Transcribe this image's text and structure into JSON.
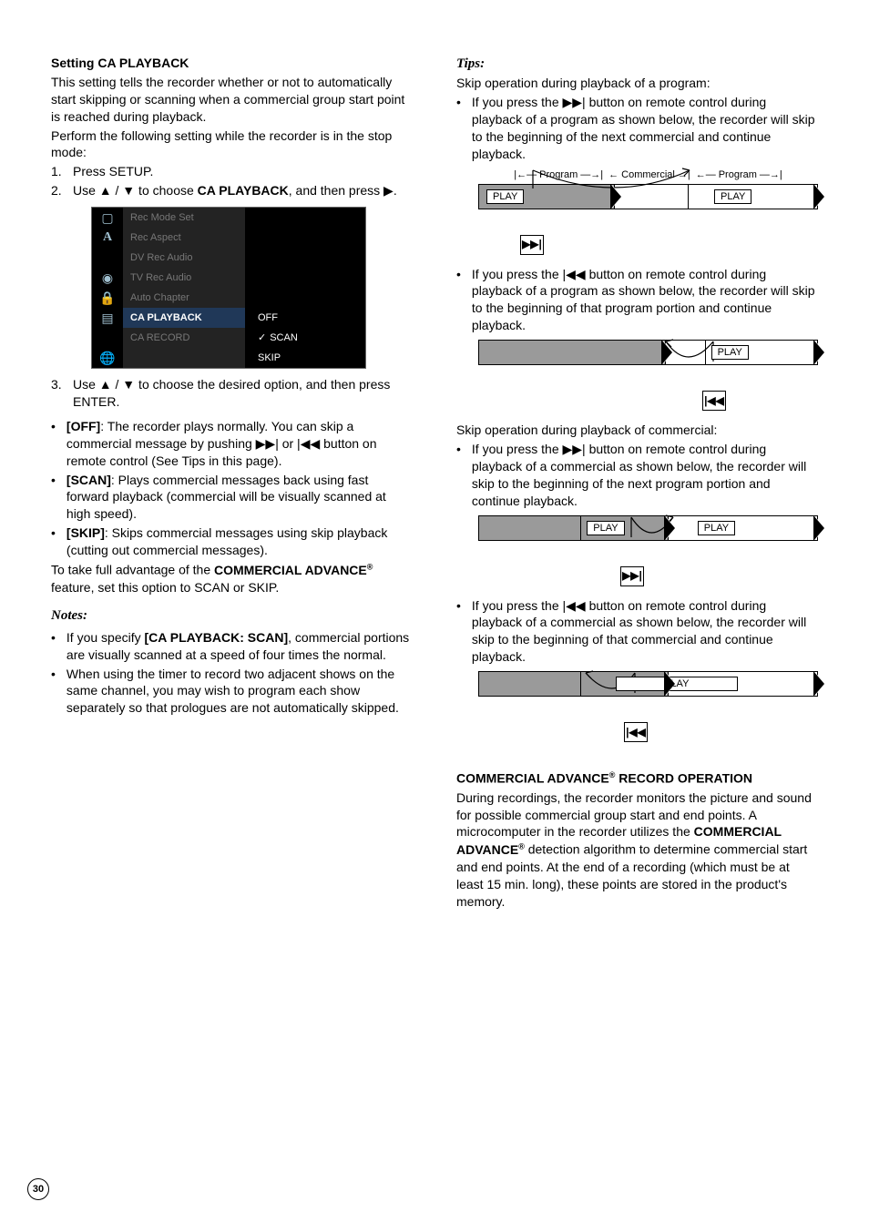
{
  "page_number": "30",
  "left": {
    "heading": "Setting CA PLAYBACK",
    "intro_p1": "This setting tells the recorder whether or not to automatically start skipping or scanning when a commercial group start point is reached during playback.",
    "intro_p2": "Perform the following setting while the recorder is in the stop mode:",
    "step1": "Press SETUP.",
    "step2_pre": "Use ▲ / ▼ to choose ",
    "step2_bold": "CA PLAYBACK",
    "step2_post": ", and then press ▶.",
    "menu": {
      "items": [
        {
          "label": "Rec Mode Set",
          "opt": ""
        },
        {
          "label": "Rec Aspect",
          "opt": ""
        },
        {
          "label": "DV Rec Audio",
          "opt": ""
        },
        {
          "label": "TV Rec Audio",
          "opt": ""
        },
        {
          "label": "Auto Chapter",
          "opt": ""
        },
        {
          "label": "CA PLAYBACK",
          "opt": "OFF",
          "active": true
        },
        {
          "label": "CA RECORD",
          "opt": "SCAN",
          "check": true
        },
        {
          "label": "",
          "opt": "SKIP"
        }
      ]
    },
    "step3": "Use ▲ / ▼ to choose the desired option, and then press ENTER.",
    "bullets": [
      {
        "b": "[OFF]",
        "t": ": The recorder plays normally. You can skip a commercial message by pushing ▶▶| or |◀◀ button on remote control (See Tips in this page)."
      },
      {
        "b": "[SCAN]",
        "t": ": Plays commercial messages back using fast forward playback (commercial will be visually scanned at high speed)."
      },
      {
        "b": "[SKIP]",
        "t": ": Skips commercial messages using skip playback (cutting out commercial messages)."
      }
    ],
    "tail_pre": "To take full advantage of the ",
    "tail_bold": "COMMERCIAL ADVANCE",
    "tail_post": " feature, set this option to SCAN or SKIP.",
    "notes_h": "Notes:",
    "notes": [
      {
        "pre": "If you specify ",
        "b": "[CA PLAYBACK: SCAN]",
        "post": ", commercial portions are visually scanned at a speed of four times the normal."
      },
      {
        "pre": "When using the timer to record two adjacent shows on the same channel, you may wish to program each show separately so that prologues are not automatically skipped.",
        "b": "",
        "post": ""
      }
    ]
  },
  "right": {
    "tips_h": "Tips:",
    "skip_prog_h": "Skip operation during playback of a program:",
    "tip1": "If you press the ▶▶| button on remote control during playback of a program as shown below, the recorder will skip to the beginning of the next commercial and continue playback.",
    "tl1_labels": {
      "a": "Program",
      "b": "Commercial",
      "c": "Program"
    },
    "play": "PLAY",
    "tip2": "If you press the |◀◀ button on remote control during playback of a program as shown below, the recorder will skip to the beginning of that program portion and continue playback.",
    "skip_comm_h": "Skip operation during playback of commercial:",
    "tip3": "If you press the ▶▶| button on remote control during playback of a commercial as shown below, the recorder will skip to the beginning of the next program portion and continue playback.",
    "tip4": "If you press the |◀◀ button on remote control during playback of a commercial as shown below, the recorder will skip to the beginning of that commercial and continue playback.",
    "rec_h_pre": "COMMERCIAL ADVANCE",
    "rec_h_post": " RECORD OPERATION",
    "rec_p_pre": "During recordings, the recorder monitors the picture and sound for possible commercial group start and end points. A microcomputer in the recorder utilizes the ",
    "rec_p_b": "COMMERCIAL ADVANCE",
    "rec_p_post": " detection algorithm to determine commercial start and end points. At the end of a recording (which must be at least 15 min. long), these points are stored in the product's memory.",
    "icon_fwd": "▶▶|",
    "icon_bwd": "|◀◀"
  }
}
